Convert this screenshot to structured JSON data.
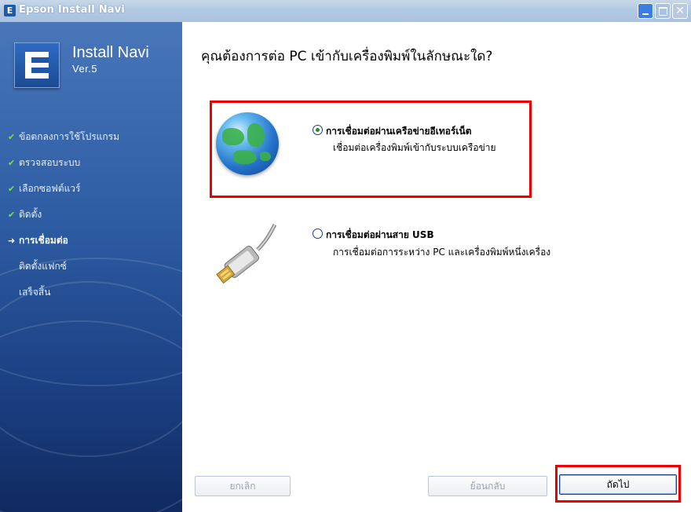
{
  "window": {
    "title": "Epson Install Navi",
    "icon_letter": "E"
  },
  "sidebar": {
    "logo_title": "Install Navi",
    "logo_version": "Ver.5",
    "steps": [
      {
        "label": "ข้อตกลงการใช้โปรแกรม",
        "status": "done"
      },
      {
        "label": "ตรวจสอบระบบ",
        "status": "done"
      },
      {
        "label": "เลือกซอฟต์แวร์",
        "status": "done"
      },
      {
        "label": "ติดตั้ง",
        "status": "done"
      },
      {
        "label": "การเชื่อมต่อ",
        "status": "current"
      },
      {
        "label": "ติดตั้งแฟกซ์",
        "status": "pending"
      },
      {
        "label": "เสร็จสิ้น",
        "status": "pending"
      }
    ]
  },
  "main": {
    "question": "คุณต้องการต่อ PC เข้ากับเครื่องพิมพ์ในลักษณะใด?",
    "options": [
      {
        "title": "การเชื่อมต่อผ่านเครือข่ายอีเทอร์เน็ต",
        "desc": "เชื่อมต่อเครื่องพิมพ์เข้ากับระบบเครือข่าย",
        "selected": true,
        "icon": "globe-icon"
      },
      {
        "title": "การเชื่อมต่อผ่านสาย USB",
        "desc": "การเชื่อมต่อการระหว่าง PC และเครื่องพิมพ์หนึ่งเครื่อง",
        "selected": false,
        "icon": "usb-cable-icon"
      }
    ]
  },
  "buttons": {
    "cancel": "ยกเลิก",
    "back": "ย้อนกลับ",
    "next": "ถัดไป"
  },
  "colors": {
    "highlight": "#e00000",
    "done_check": "#7be04a",
    "sidebar": "#2e5da4"
  }
}
